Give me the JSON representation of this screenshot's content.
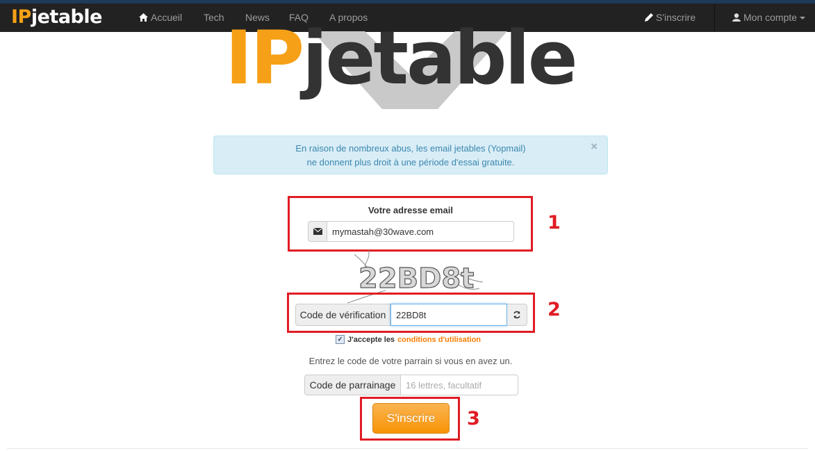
{
  "navbar": {
    "brand_ip": "IP",
    "brand_rest": "jetable",
    "items": [
      {
        "label": "Accueil",
        "icon": "home-icon"
      },
      {
        "label": "Tech"
      },
      {
        "label": "News"
      },
      {
        "label": "FAQ"
      },
      {
        "label": "A propos"
      }
    ],
    "signup": {
      "label": "S'inscrire",
      "icon": "pencil-icon"
    },
    "account": {
      "label": "Mon compte",
      "icon": "user-icon"
    }
  },
  "logo": {
    "ip": "IP",
    "rest": "jetable"
  },
  "alert": {
    "line1": "En raison de nombreux abus, les email jetables (Yopmail)",
    "line2": "ne donnent plus droit à une période d'essai gratuite.",
    "close": "×"
  },
  "form": {
    "email_label": "Votre adresse email",
    "email_value": "mymastah@30wave.com",
    "captcha_text": "22BD8t",
    "code_label": "Code de vérification",
    "code_value": "22BD8t",
    "terms_prefix": "J'accepte les",
    "terms_link": "conditions d'utilisation",
    "terms_checked": true,
    "referral_text": "Entrez le code de votre parrain si vous en avez un.",
    "referral_label": "Code de parrainage",
    "referral_placeholder": "16 lettres, facultatif",
    "submit_label": "S'inscrire"
  },
  "annotations": {
    "step1": "1",
    "step2": "2",
    "step3": "3"
  },
  "colors": {
    "brand_orange": "#f5a016",
    "navbar": "#222222",
    "annotation_red": "#e01c24",
    "alert_bg": "#d9edf7",
    "link_orange": "#f57d00"
  }
}
